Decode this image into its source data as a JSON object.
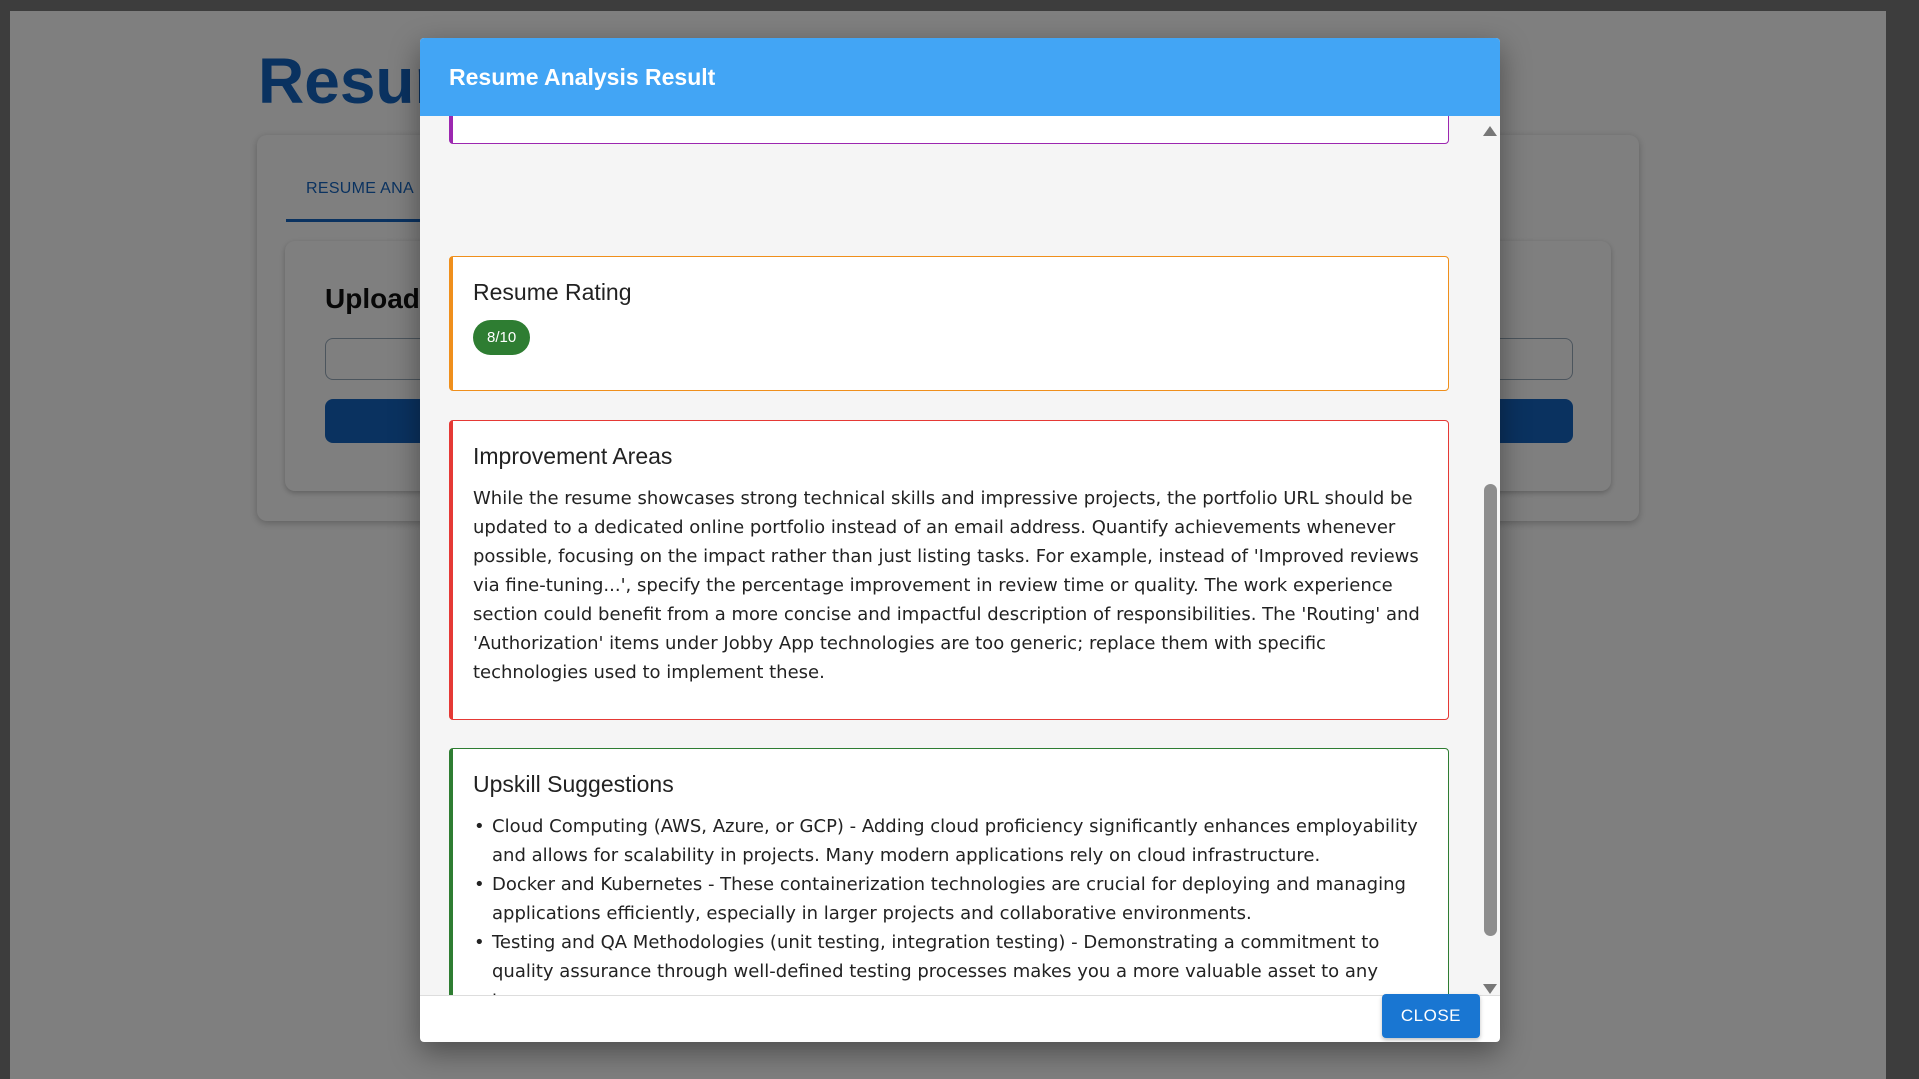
{
  "background": {
    "title": "Resur",
    "tab_label": "RESUME ANA",
    "upload_heading": "Upload"
  },
  "modal": {
    "title": "Resume Analysis Result",
    "rating": {
      "heading": "Resume Rating",
      "value": "8/10"
    },
    "improvement": {
      "heading": "Improvement Areas",
      "text": "While the resume showcases strong technical skills and impressive projects, the portfolio URL should be updated to a dedicated online portfolio instead of an email address. Quantify achievements whenever possible, focusing on the impact rather than just listing tasks. For example, instead of 'Improved reviews via fine-tuning...', specify the percentage improvement in review time or quality. The work experience section could benefit from a more concise and impactful description of responsibilities. The 'Routing' and 'Authorization' items under Jobby App technologies are too generic; replace them with specific technologies used to implement these."
    },
    "upskill": {
      "heading": "Upskill Suggestions",
      "items": [
        "Cloud Computing (AWS, Azure, or GCP) - Adding cloud proficiency significantly enhances employability and allows for scalability in projects. Many modern applications rely on cloud infrastructure.",
        "Docker and Kubernetes - These containerization technologies are crucial for deploying and managing applications efficiently, especially in larger projects and collaborative environments.",
        "Testing and QA Methodologies (unit testing, integration testing) - Demonstrating a commitment to quality assurance through well-defined testing processes makes you a more valuable asset to any team."
      ]
    },
    "close_label": "CLOSE"
  },
  "colors": {
    "header": "#42a5f5",
    "skills_border": "#9c27b0",
    "rating_border": "#ef8f1c",
    "improvement_border": "#e53935",
    "upskill_border": "#2e7d32",
    "badge": "#2e7d32",
    "close_button": "#1976d2"
  }
}
